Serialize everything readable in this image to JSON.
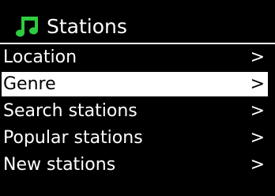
{
  "header": {
    "title": "Stations",
    "icon": "music-note-icon",
    "icon_color": "#2ecc40"
  },
  "menu": {
    "items": [
      {
        "label": "Location",
        "arrow": ">",
        "selected": false
      },
      {
        "label": "Genre",
        "arrow": ">",
        "selected": true
      },
      {
        "label": "Search stations",
        "arrow": ">",
        "selected": false
      },
      {
        "label": "Popular stations",
        "arrow": ">",
        "selected": false
      },
      {
        "label": "New stations",
        "arrow": ">",
        "selected": false
      }
    ]
  },
  "colors": {
    "background": "#000000",
    "text": "#ffffff",
    "selected_background": "#ffffff",
    "selected_text": "#000000"
  }
}
